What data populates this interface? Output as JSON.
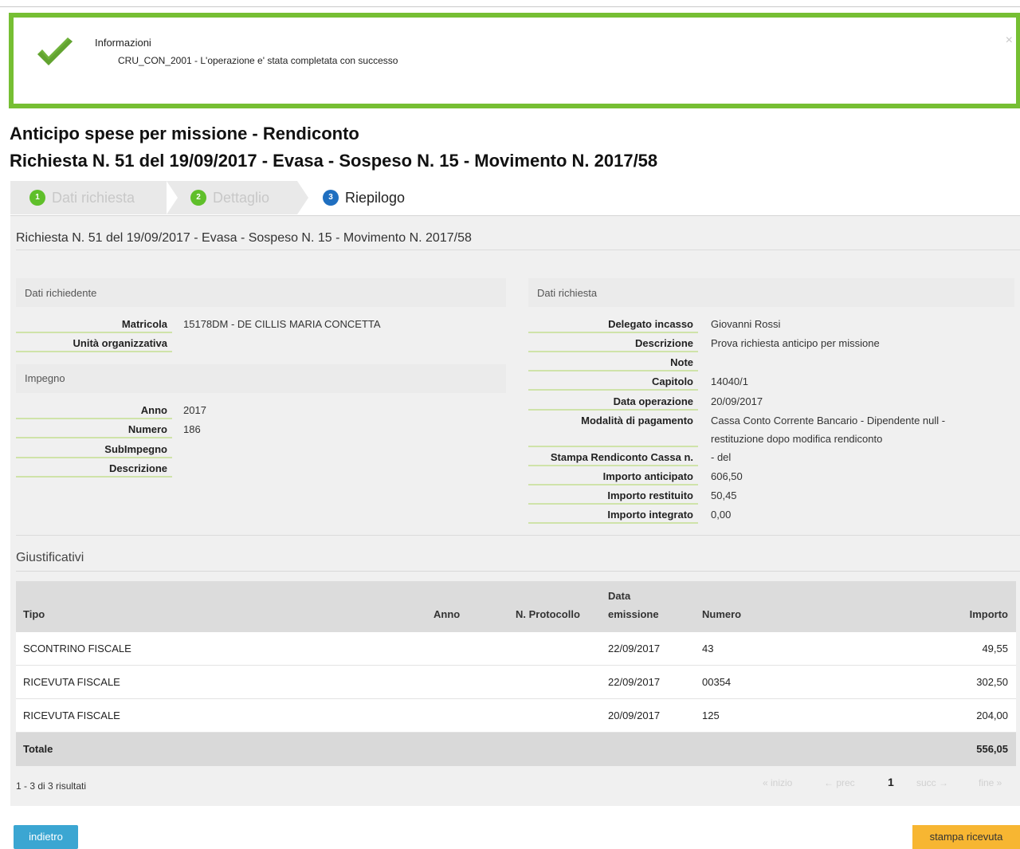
{
  "alert": {
    "title": "Informazioni",
    "message": "CRU_CON_2001 - L'operazione e' stata completata con successo",
    "close": "×"
  },
  "page": {
    "title": "Anticipo spese per missione - Rendiconto",
    "subtitle": "Richiesta N. 51 del 19/09/2017 - Evasa - Sospeso N. 15 - Movimento N. 2017/58"
  },
  "wizard": {
    "steps": [
      {
        "num": "1",
        "label": "Dati richiesta"
      },
      {
        "num": "2",
        "label": "Dettaglio"
      },
      {
        "num": "3",
        "label": "Riepilogo"
      }
    ]
  },
  "panel": {
    "title": "Richiesta N. 51 del 19/09/2017 - Evasa - Sospeso N. 15 - Movimento N. 2017/58"
  },
  "richiedente": {
    "heading": "Dati richiedente",
    "fields": [
      {
        "key": "Matricola",
        "value": "15178DM - DE CILLIS MARIA CONCETTA"
      },
      {
        "key": "Unità organizzativa",
        "value": ""
      }
    ]
  },
  "impegno": {
    "heading": "Impegno",
    "fields": [
      {
        "key": "Anno",
        "value": "2017"
      },
      {
        "key": "Numero",
        "value": "186"
      },
      {
        "key": "SubImpegno",
        "value": ""
      },
      {
        "key": "Descrizione",
        "value": ""
      }
    ]
  },
  "richiesta": {
    "heading": "Dati richiesta",
    "fields": [
      {
        "key": "Delegato incasso",
        "value": "Giovanni Rossi"
      },
      {
        "key": "Descrizione",
        "value": "Prova richiesta anticipo per missione"
      },
      {
        "key": "Note",
        "value": ""
      },
      {
        "key": "Capitolo",
        "value": "14040/1"
      },
      {
        "key": "Data operazione",
        "value": "20/09/2017"
      },
      {
        "key": "Modalità di pagamento",
        "value": "Cassa Conto Corrente Bancario - Dipendente null -",
        "value2": "restituzione dopo modifica rendiconto"
      },
      {
        "key": "Stampa Rendiconto Cassa n.",
        "value": "- del"
      },
      {
        "key": "Importo anticipato",
        "value": "606,50"
      },
      {
        "key": "Importo restituito",
        "value": "50,45"
      },
      {
        "key": "Importo integrato",
        "value": "0,00"
      }
    ]
  },
  "giustificativi": {
    "heading": "Giustificativi",
    "columns": {
      "tipo": "Tipo",
      "anno": "Anno",
      "protocollo": "N. Protocollo",
      "data_line1": "Data",
      "data_line2": "emissione",
      "numero": "Numero",
      "importo": "Importo"
    },
    "rows": [
      {
        "tipo": "SCONTRINO FISCALE",
        "anno": "",
        "protocollo": "",
        "data": "22/09/2017",
        "numero": "43",
        "importo": "49,55"
      },
      {
        "tipo": "RICEVUTA FISCALE",
        "anno": "",
        "protocollo": "",
        "data": "22/09/2017",
        "numero": "00354",
        "importo": "302,50"
      },
      {
        "tipo": "RICEVUTA FISCALE",
        "anno": "",
        "protocollo": "",
        "data": "20/09/2017",
        "numero": "125",
        "importo": "204,00"
      }
    ],
    "total_label": "Totale",
    "total_value": "556,05"
  },
  "pagination": {
    "info": "1 - 3 di 3 risultati",
    "first": "« inizio",
    "prev": "← prec",
    "current": "1",
    "next": "succ →",
    "last": "fine »"
  },
  "buttons": {
    "back": "indietro",
    "print": "stampa ricevuta"
  },
  "colors": {
    "alert_border": "#76bf33",
    "step_done": "#5fbf2a",
    "step_active": "#1f6fc0",
    "back_button": "#3ba6d2",
    "print_button": "#f7b632",
    "field_underline": "#cfe3a9"
  }
}
